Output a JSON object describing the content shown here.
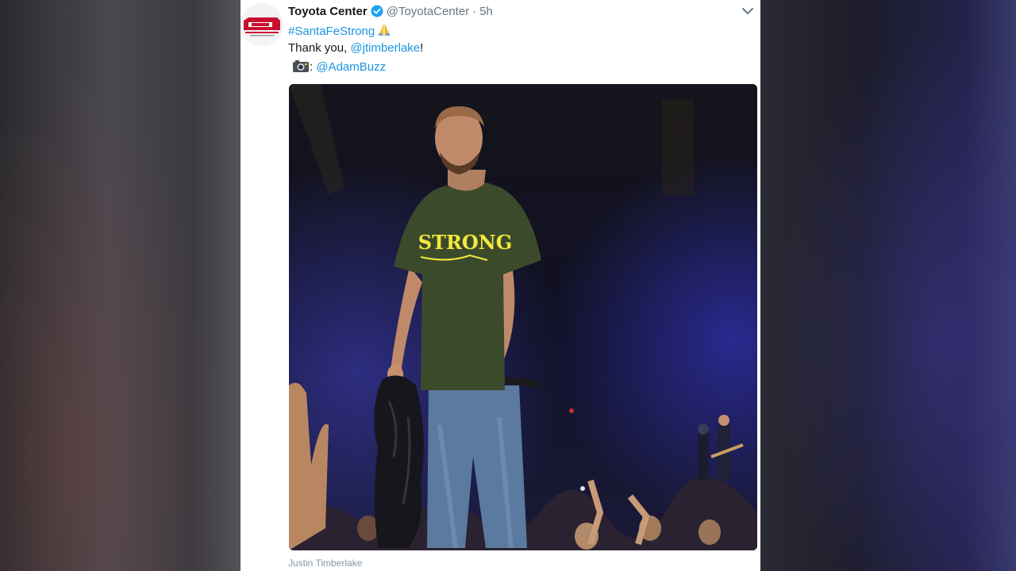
{
  "tweet": {
    "display_name": "Toyota Center",
    "verified_icon": "verified-badge-icon",
    "handle": "@ToyotaCenter",
    "separator": "·",
    "time": "5h",
    "hashtag": "#SantaFeStrong",
    "thank_prefix": "Thank you, ",
    "mention": "@jtimberlake",
    "thank_suffix": "!",
    "photo_credit_sep": ": ",
    "photo_credit_handle": "@AdamBuzz",
    "shirt_text": "STRONG",
    "media_caption": "Justin Timberlake"
  },
  "icons": {
    "avatar": "toyota-center-logo-icon",
    "pray": "folded-hands-icon",
    "camera": "camera-icon",
    "menu": "chevron-down-icon"
  },
  "colors": {
    "link": "#1b95e0",
    "text": "#14171a",
    "muted": "#657786",
    "verified": "#1da1f2",
    "shirt_text": "#f2ea3a"
  }
}
